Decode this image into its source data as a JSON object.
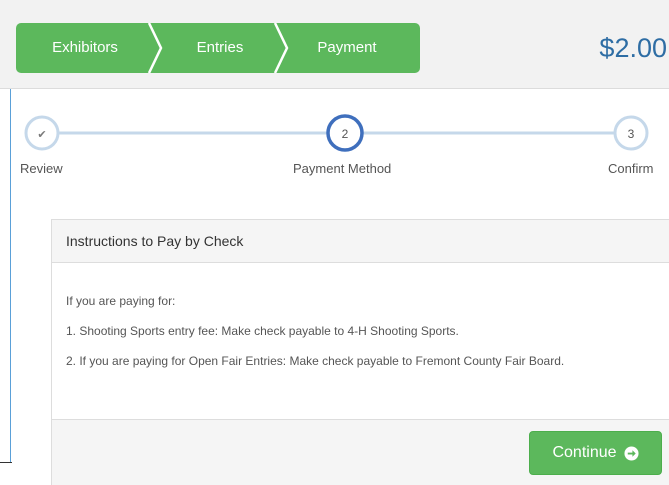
{
  "breadcrumb": {
    "items": [
      {
        "label": "Exhibitors"
      },
      {
        "label": "Entries"
      },
      {
        "label": "Payment"
      }
    ],
    "color": "#5cb85c"
  },
  "total": "$2.00",
  "stepper": {
    "steps": [
      {
        "label": "Review",
        "marker": "✔",
        "state": "completed"
      },
      {
        "label": "Payment Method",
        "marker": "2",
        "state": "active"
      },
      {
        "label": "Confirm",
        "marker": "3",
        "state": "upcoming"
      }
    ],
    "line_color": "#c5d8ea",
    "active_color": "#3f6fbd"
  },
  "panel": {
    "title": "Instructions to Pay by Check",
    "lines": [
      "If you are paying for:",
      "1. Shooting Sports entry fee: Make check payable to 4-H Shooting Sports.",
      "2. If you are paying for Open Fair Entries: Make check payable to Fremont County Fair Board."
    ],
    "continue_label": "Continue",
    "continue_icon": "arrow-circle-right-icon"
  }
}
